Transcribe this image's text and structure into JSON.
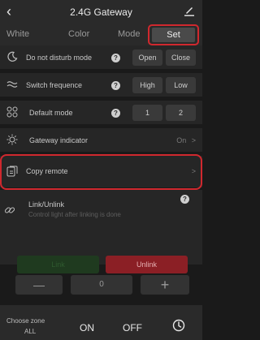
{
  "header": {
    "title": "2.4G Gateway"
  },
  "tabs": [
    {
      "label": "White"
    },
    {
      "label": "Color"
    },
    {
      "label": "Mode"
    },
    {
      "label": "Set"
    }
  ],
  "settings": {
    "dnd": {
      "label": "Do not disturb mode",
      "help": "?",
      "options": [
        "Open",
        "Close"
      ]
    },
    "switch": {
      "label": "Switch frequence",
      "help": "?",
      "options": [
        "High",
        "Low"
      ]
    },
    "default": {
      "label": "Default mode",
      "help": "?",
      "options": [
        "1",
        "2"
      ]
    },
    "indicator": {
      "label": "Gateway indicator",
      "value": "On",
      "arrow": ">"
    },
    "copy": {
      "label": "Copy remote",
      "arrow": ">"
    }
  },
  "link": {
    "title": "Link/Unlink",
    "subtitle": "Control light after linking is done",
    "help": "?",
    "link_label": "Link",
    "unlink_label": "Unlink"
  },
  "stepper": {
    "minus": "—",
    "value": "0",
    "plus": "+"
  },
  "bottom": {
    "choose_zone": "Choose zone",
    "zone_value": "ALL",
    "on_label": "ON",
    "off_label": "OFF"
  },
  "colors": {
    "accent_red": "#d0282e",
    "unlink_bg": "#8b1f25",
    "link_bg": "#1f3a1f"
  },
  "icons": {
    "back": "back-chevron-icon",
    "edit": "pencil-icon",
    "dnd": "moon-icon",
    "switch": "wave-icon",
    "default": "grid-icon",
    "indicator": "sun-icon",
    "copy": "copy-icon",
    "link": "link-icon",
    "clock": "clock-icon"
  }
}
